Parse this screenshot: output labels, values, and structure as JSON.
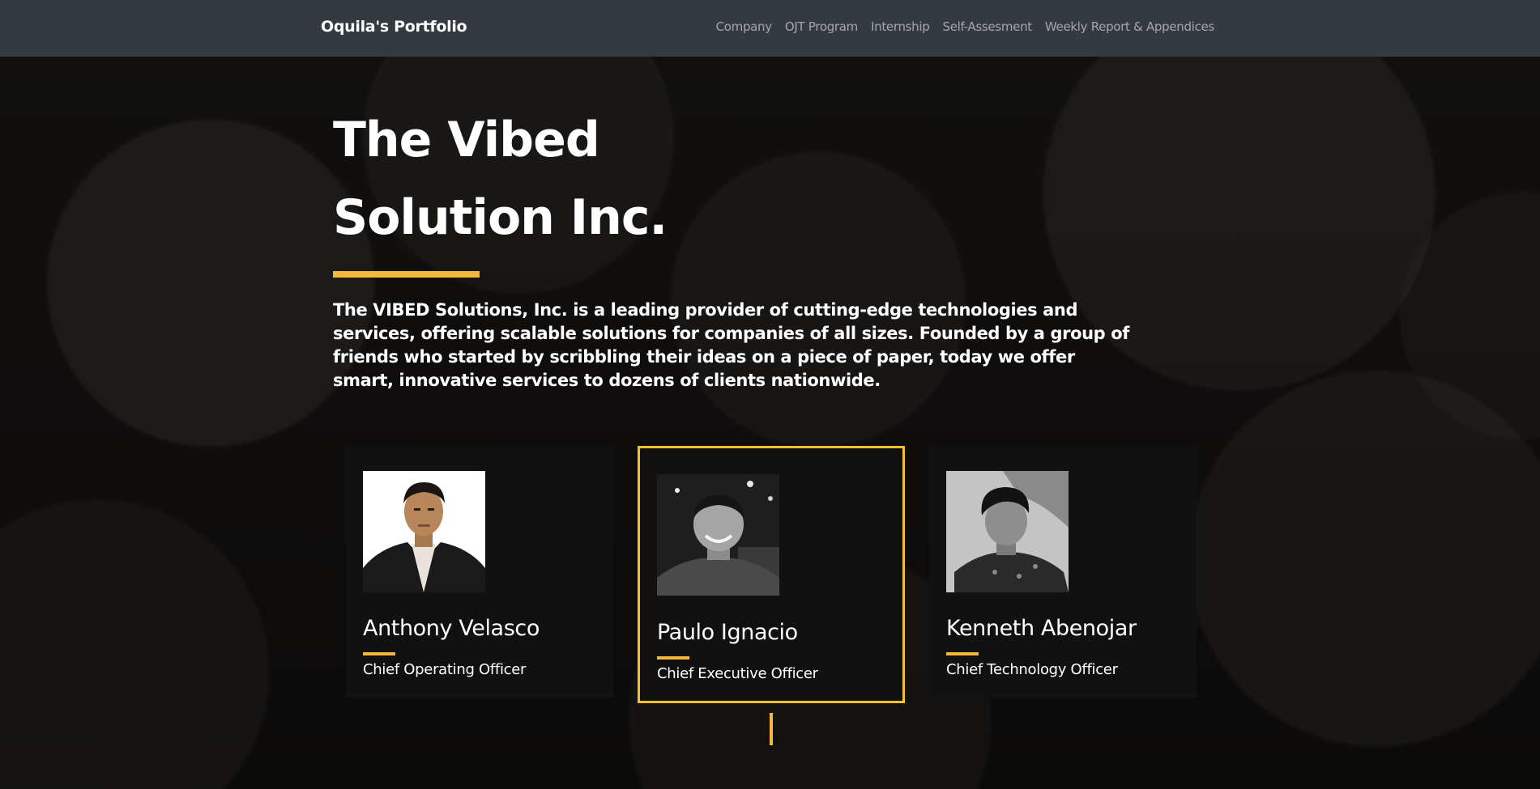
{
  "navbar": {
    "brand": "Oquila's Portfolio",
    "links": [
      "Company",
      "OJT Program",
      "Internship",
      "Self-Assesment",
      "Weekly Report & Appendices"
    ]
  },
  "hero": {
    "title_line1": "The Vibed",
    "title_line2": "Solution Inc.",
    "description": "The VIBED Solutions, Inc. is a leading provider of cutting-edge technologies and services, offering scalable solutions for companies of all sizes. Founded by a group of friends who started by scribbling their ideas on a piece of paper, today we offer smart, innovative services to dozens of clients nationwide."
  },
  "team": [
    {
      "name": "Anthony Velasco",
      "role": "Chief Operating Officer",
      "active": false
    },
    {
      "name": "Paulo Ignacio",
      "role": "Chief Executive Officer",
      "active": true
    },
    {
      "name": "Kenneth Abenojar",
      "role": "Chief Technology Officer",
      "active": false
    }
  ],
  "colors": {
    "navbar": "#343a40",
    "accent": "#f5b83d",
    "active_border": "#f5c02a",
    "card": "#111111"
  }
}
